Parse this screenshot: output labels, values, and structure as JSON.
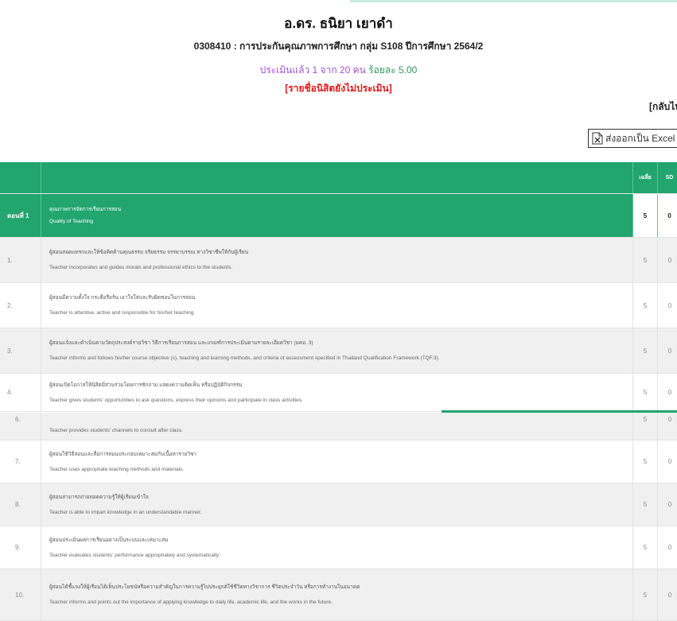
{
  "header": {
    "instructor": "อ.ดร. ธนิยา เยาดำ",
    "course": "0308410 : การประกันคุณภาพการศึกษา กลุ่ม S108 ปีการศึกษา 2564/2",
    "progress_part1": "ประเมินแล้ว 1 จาก 20 คน",
    "progress_part2": "ร้อยละ 5.00",
    "not_evaluated_link": "[รายชื่อนิสิตยังไม่ประเมิน]",
    "back_link": "[กลับไป",
    "export_label": "ส่งออกเป็น Excel"
  },
  "colors": {
    "header_green": "#22a56f",
    "progress_purple": "#a14fd6",
    "progress_green": "#2c9a5a",
    "link_red": "#e3171c"
  },
  "table": {
    "col_avg": "เฉลี่ย",
    "col_sd": "SD",
    "section": {
      "label": "ตอนที่ 1",
      "th": "คุณภาพการจัดการเรียนการสอน",
      "en": "Quality of Teaching",
      "avg": "5",
      "sd": "0"
    },
    "rows": [
      {
        "num": "1.",
        "th": "ผู้สอนสอดแทรกและให้ข้อคิดด้านคุณธรรม จริยธรรม จรรยาบรรณ ทางวิชาชีพให้กับผู้เรียน",
        "en": "Teacher incorporates and guides morals and professional ethics to the students.",
        "avg": "5",
        "sd": "0"
      },
      {
        "num": "2.",
        "th": "ผู้สอนมีความตั้งใจ กระตือรือร้น เอาใจใส่และรับผิดชอบในการสอน",
        "en": "Teacher is attentive, active and responsible for his/her teaching.",
        "avg": "5",
        "sd": "0"
      },
      {
        "num": "3.",
        "th": "ผู้สอนแจ้งและดำเนินตามวัตถุประสงค์รายวิชา วิธีการเรียนการสอน และเกณฑ์การประเมินตามรายละเอียดวิชา (มคอ. 3)",
        "en": "Teacher informs and follows his/her course objective (s), teaching and learning methods, and criteria of assessment specified in Thailand Qualification Framework (TQF.3).",
        "avg": "5",
        "sd": "0"
      },
      {
        "num": "4.",
        "th": "ผู้สอนเปิดโอกาสให้นิสิตมีส่วนร่วมโดยการซักถาม แสดงความคิดเห็น หรือปฏิบัติกิจกรรม",
        "en": "Teacher gives students' opportunities to ask questions, express their opinions and participate in class activities.",
        "avg": "5",
        "sd": "0"
      },
      {
        "num": "6.",
        "th": "",
        "en": "Teacher provides students' channels to consult after class.",
        "avg": "5",
        "sd": "0"
      },
      {
        "num": "7.",
        "th": "ผู้สอนใช้วิธีสอนและสื่อการสอนประกอบเหมาะสมกับเนื้อหารายวิชา",
        "en": "Teacher uses appropriate teaching methods and materials.",
        "avg": "5",
        "sd": "0"
      },
      {
        "num": "8.",
        "th": "ผู้สอนสามารถถ่ายทอดความรู้ให้ผู้เรียนเข้าใจ",
        "en": "Teacher is able to impart knowledge in an understandable manner.",
        "avg": "5",
        "sd": "0"
      },
      {
        "num": "9.",
        "th": "ผู้สอนประเมินผลการเรียนอย่างเป็นระบบและเหมาะสม",
        "en": "Teacher evaluates students' performance appropriately and systematically.",
        "avg": "5",
        "sd": "0"
      },
      {
        "num": "10.",
        "th": "ผู้สอนได้ชี้แจงให้ผู้เรียนได้เห็นประโยชน์หรือความสำคัญในการความรู้ไปประยุกต์ใช้ชีวิตทางวิชาการ ชีวิตประจำวัน หรือการทำงานในอนาคต",
        "en": "Teacher informs and points out the importance of applying knowledge to daily life, academic life, and the works in the future.",
        "avg": "5",
        "sd": "0"
      }
    ]
  }
}
